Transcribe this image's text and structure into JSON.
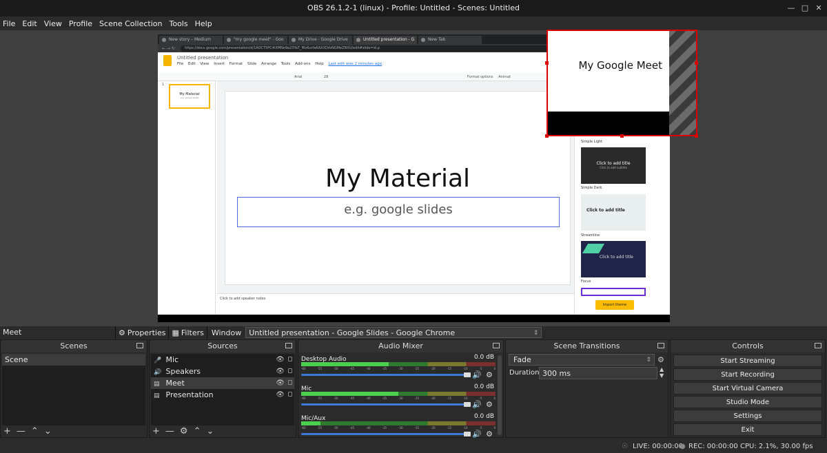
{
  "window": {
    "title": "OBS 26.1.2-1 (linux) - Profile: Untitled - Scenes: Untitled"
  },
  "menu": [
    "File",
    "Edit",
    "View",
    "Profile",
    "Scene Collection",
    "Tools",
    "Help"
  ],
  "preview": {
    "browser": {
      "tabs": [
        "New story – Medium",
        "\"my google meet\" - Goo",
        "My Drive - Google Drive",
        "Untitled presentation - G",
        "New Tab"
      ],
      "url": "https://docs.google.com/presentation/d/1AOCT5PC4lXMNo9a23YaT_fRz6urfaKAXXDrbNGMeZNXU/edit#slide=id.p",
      "doc_title": "Untitled presentation",
      "doc_menu": [
        "File",
        "Edit",
        "View",
        "Insert",
        "Format",
        "Slide",
        "Arrange",
        "Tools",
        "Add-ons",
        "Help"
      ],
      "last_edit": "Last edit was 2 minutes ago",
      "font_name": "Arial",
      "font_size": "28",
      "format_options": "Format options",
      "animate": "Animat",
      "thumb_title": "My Material",
      "thumb_sub": "e.g. google slides",
      "thumb_num": "1",
      "slide_title": "My Material",
      "slide_subtitle": "e.g. google slides",
      "speaker_notes": "Click to add speaker notes",
      "themes": [
        {
          "label": "Simple Light",
          "card_text": "Click to add title",
          "card_sub": "Click to add subtitle"
        },
        {
          "label": "Simple Dark",
          "card_text": "Click to add title",
          "card_sub": ""
        },
        {
          "label": "Streamline",
          "card_text": "Click to add title",
          "card_sub": ""
        },
        {
          "label": "Focus",
          "card_text": "",
          "card_sub": ""
        }
      ],
      "import_theme": "Import theme"
    },
    "meet": {
      "text": "My Google Meet"
    }
  },
  "source_toolbar": {
    "selected_source": "Meet",
    "properties": "Properties",
    "filters": "Filters",
    "window_label": "Window",
    "window_value": "Untitled presentation - Google Slides - Google Chrome"
  },
  "scenes": {
    "title": "Scenes",
    "items": [
      "Scene"
    ]
  },
  "sources": {
    "title": "Sources",
    "items": [
      {
        "name": "Mic",
        "icon": "microphone-icon"
      },
      {
        "name": "Speakers",
        "icon": "speaker-icon"
      },
      {
        "name": "Meet",
        "icon": "window-icon"
      },
      {
        "name": "Presentation",
        "icon": "window-icon"
      }
    ]
  },
  "mixer": {
    "title": "Audio Mixer",
    "ticks": [
      "-60",
      "-55",
      "-50",
      "-45",
      "-40",
      "-35",
      "-30",
      "-25",
      "-20",
      "-15",
      "-10",
      "-5",
      "0"
    ],
    "channels": [
      {
        "name": "Desktop Audio",
        "db": "0.0 dB",
        "level": 0.45
      },
      {
        "name": "Mic",
        "db": "0.0 dB",
        "level": 0.5
      },
      {
        "name": "Mic/Aux",
        "db": "0.0 dB",
        "level": 0.1
      }
    ]
  },
  "transitions": {
    "title": "Scene Transitions",
    "selected": "Fade",
    "duration_label": "Duration",
    "duration_value": "300 ms"
  },
  "controls": {
    "title": "Controls",
    "buttons": [
      "Start Streaming",
      "Start Recording",
      "Start Virtual Camera",
      "Studio Mode",
      "Settings",
      "Exit"
    ]
  },
  "status": {
    "live": "LIVE: 00:00:00",
    "rec": "REC: 00:00:00",
    "cpu": "CPU: 2.1%, 30.00 fps"
  }
}
